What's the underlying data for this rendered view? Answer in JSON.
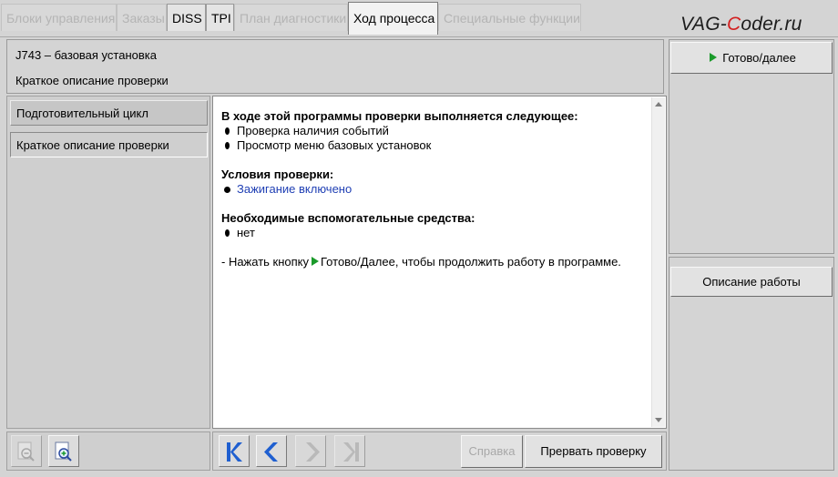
{
  "tabs": [
    {
      "label": "Блоки управления",
      "state": "disabled"
    },
    {
      "label": "Заказы",
      "state": "disabled"
    },
    {
      "label": "DISS",
      "state": "enabled"
    },
    {
      "label": "TPI",
      "state": "enabled"
    },
    {
      "label": "План диагностики",
      "state": "disabled"
    },
    {
      "label": "Ход процесса",
      "state": "active"
    },
    {
      "label": "Специальные функции",
      "state": "disabled"
    }
  ],
  "brand": {
    "part1": "VAG-",
    "part2": "C",
    "part3": "oder.ru"
  },
  "header": {
    "title": "J743 – базовая установка",
    "subtitle": "Краткое описание проверки"
  },
  "steps": [
    {
      "label": "Подготовительный цикл"
    },
    {
      "label": "Краткое описание проверки"
    }
  ],
  "content": {
    "section1_title": "В ходе этой программы проверки выполняется следующее:",
    "section1_items": [
      "Проверка наличия событий",
      "Просмотр меню базовых установок"
    ],
    "section2_title": "Условия проверки:",
    "section2_items": [
      "Зажигание включено"
    ],
    "section3_title": "Необходимые вспомогательные средства:",
    "section3_items": [
      "нет"
    ],
    "instruction_prefix": "- Нажать кнопку",
    "instruction_suffix": "Готово/Далее, чтобы продолжить работу в программе."
  },
  "right": {
    "ready_label": "Готово/далее",
    "desc_label": "Описание работы"
  },
  "toolbar": {
    "help_label": "Справка",
    "abort_label": "Прервать проверку"
  },
  "icons": {
    "zoom_out": "zoom-out-icon",
    "zoom_in": "zoom-in-icon",
    "first": "first-page-icon",
    "prev": "previous-icon",
    "next": "next-icon",
    "last": "last-page-icon",
    "play": "play-icon"
  },
  "colors": {
    "accent_blue": "#1f5fd0",
    "play_green": "#1a9a2a",
    "link_blue": "#1f3fb4",
    "brand_red": "#d32020"
  }
}
